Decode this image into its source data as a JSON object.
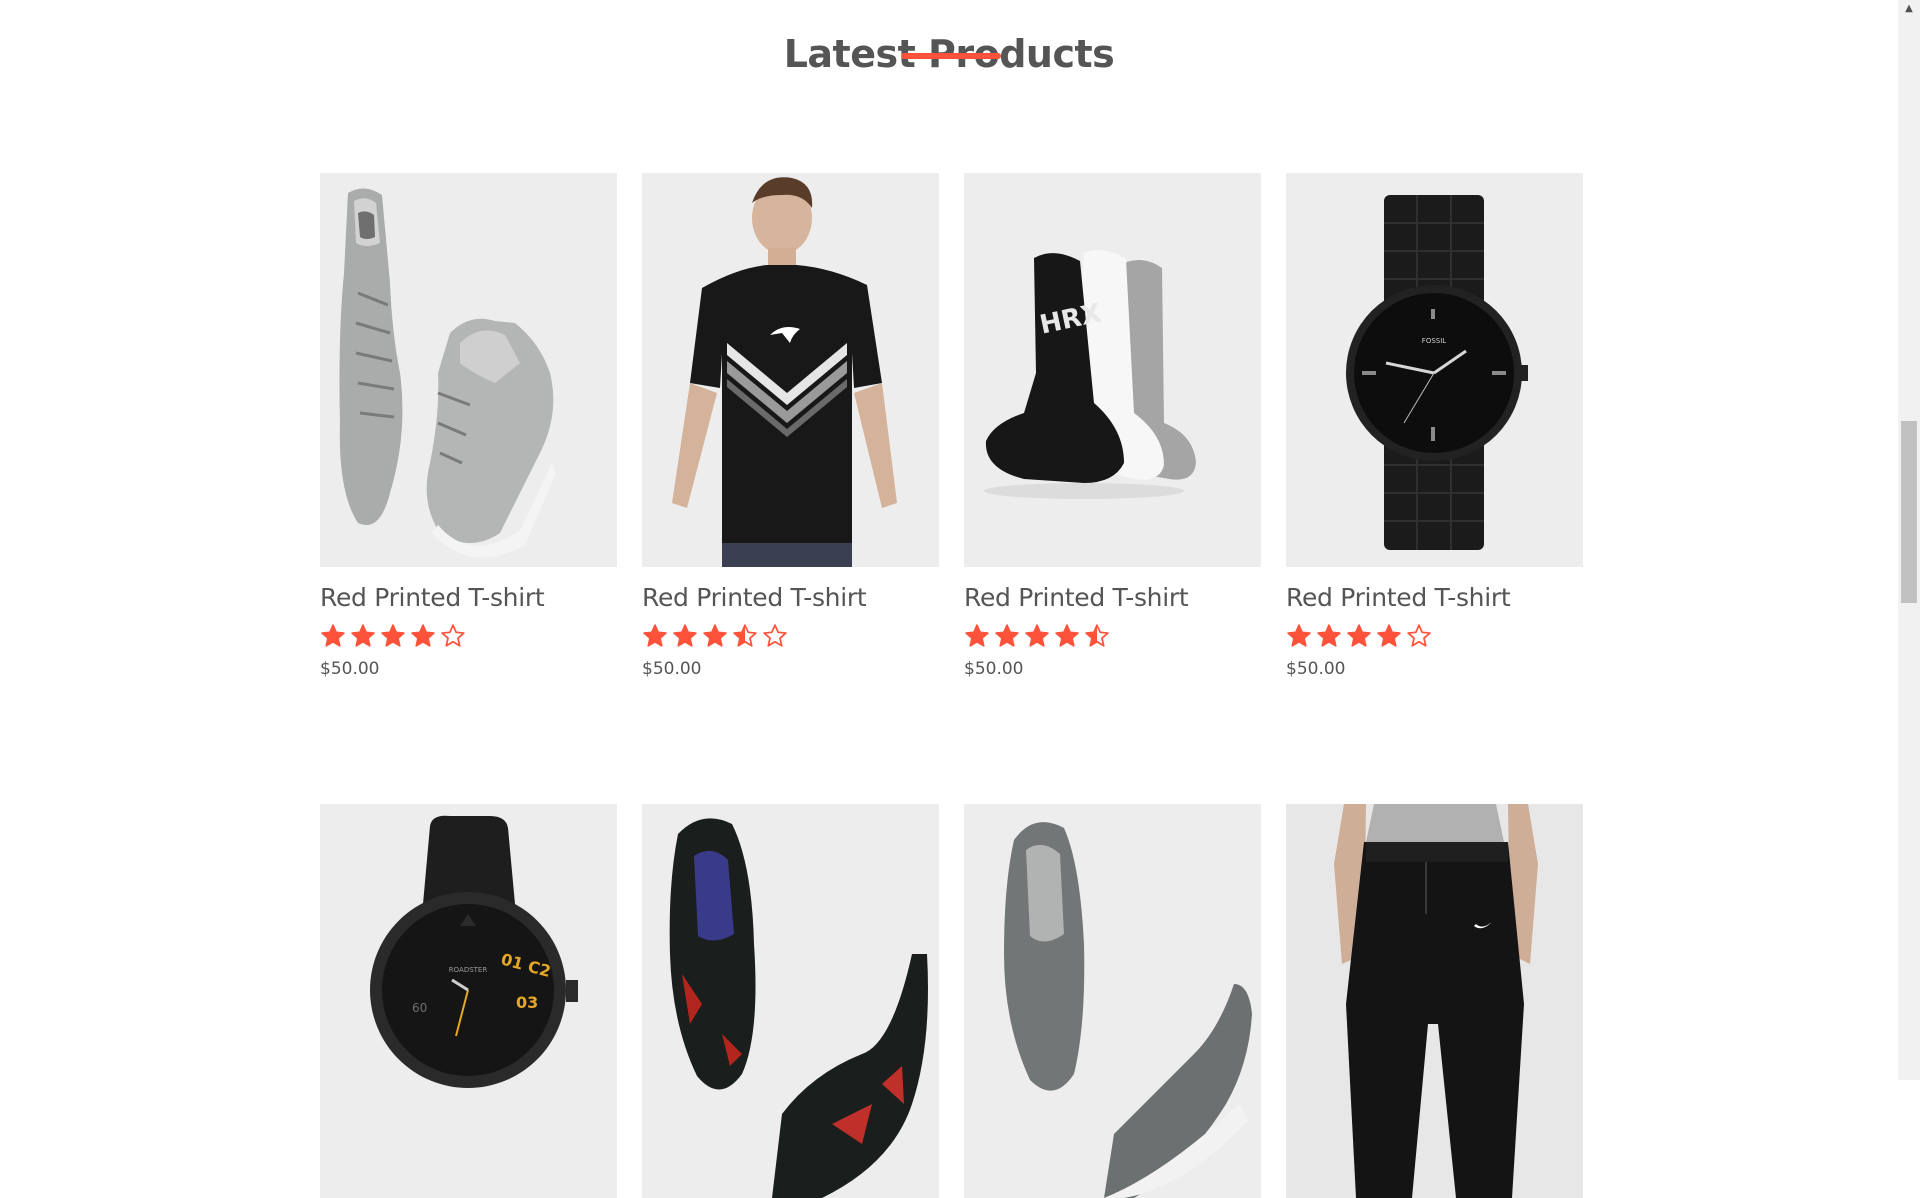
{
  "section": {
    "title": "Latest Products"
  },
  "colors": {
    "accent": "#ff523b",
    "text": "#555555",
    "image_bg": "#ededed"
  },
  "products_row1": [
    {
      "title": "Red Printed T-shirt",
      "rating": 4,
      "price": "$50.00",
      "image": "high-top-sneakers"
    },
    {
      "title": "Red Printed T-shirt",
      "rating": 3.5,
      "price": "$50.00",
      "image": "puma-black-tshirt"
    },
    {
      "title": "Red Printed T-shirt",
      "rating": 4.5,
      "price": "$50.00",
      "image": "hrx-socks"
    },
    {
      "title": "Red Printed T-shirt",
      "rating": 4,
      "price": "$50.00",
      "image": "fossil-black-watch"
    }
  ],
  "products_row2": [
    {
      "image": "roadster-analog-watch"
    },
    {
      "image": "black-red-running-shoes"
    },
    {
      "image": "grey-slip-on-shoes"
    },
    {
      "image": "black-jogger-pants"
    }
  ],
  "scrollbar": {
    "up_icon": "arrow-up-icon"
  }
}
